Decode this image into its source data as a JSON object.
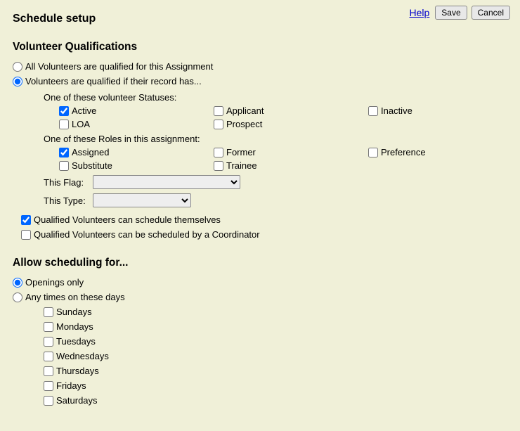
{
  "header": {
    "title": "Schedule setup",
    "help": "Help",
    "save": "Save",
    "cancel": "Cancel"
  },
  "qualifications": {
    "title": "Volunteer Qualifications",
    "option_all": "All Volunteers are qualified for this Assignment",
    "option_if": "Volunteers are qualified if their record has...",
    "statuses_heading": "One of these volunteer Statuses:",
    "roles_heading": "One of these Roles in this assignment:",
    "statuses": {
      "active": "Active",
      "applicant": "Applicant",
      "inactive": "Inactive",
      "loa": "LOA",
      "prospect": "Prospect"
    },
    "roles": {
      "assigned": "Assigned",
      "former": "Former",
      "preference": "Preference",
      "substitute": "Substitute",
      "trainee": "Trainee"
    },
    "flag_label": "This Flag:",
    "type_label": "This Type:",
    "self_schedule": "Qualified Volunteers can schedule themselves",
    "coordinator_schedule": "Qualified Volunteers can be scheduled by a Coordinator"
  },
  "allow": {
    "title": "Allow scheduling for...",
    "openings_only": "Openings only",
    "any_days": "Any times on these days",
    "days": {
      "sun": "Sundays",
      "mon": "Mondays",
      "tue": "Tuesdays",
      "wed": "Wednesdays",
      "thu": "Thursdays",
      "fri": "Fridays",
      "sat": "Saturdays"
    }
  }
}
